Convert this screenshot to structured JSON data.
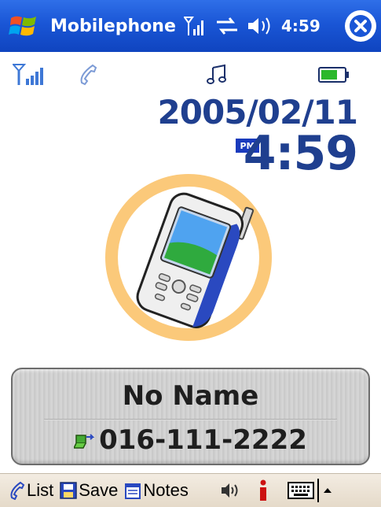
{
  "titlebar": {
    "app_title": "Mobilephone",
    "clock": "4:59",
    "icons": [
      "windows-start-icon",
      "signal-icon",
      "connectivity-icon",
      "speaker-icon",
      "close-icon"
    ]
  },
  "indicators": {
    "icons": [
      "signal-strength-icon",
      "phone-handset-icon",
      "music-note-icon",
      "battery-icon"
    ]
  },
  "datetime": {
    "date": "2005/02/11",
    "ampm": "PM",
    "time": "4:59"
  },
  "caller": {
    "name": "No Name",
    "number": "016-111-2222",
    "ring_color": "#fbc97a"
  },
  "menubar": {
    "list_label": "List",
    "save_label": "Save",
    "notes_label": "Notes",
    "icons": [
      "volume-icon",
      "info-icon",
      "keyboard-icon",
      "up-arrow-icon"
    ]
  },
  "colors": {
    "titlebar": "#1a56d6",
    "accent_text": "#1f3f8f",
    "menubar": "#e5dac9"
  }
}
